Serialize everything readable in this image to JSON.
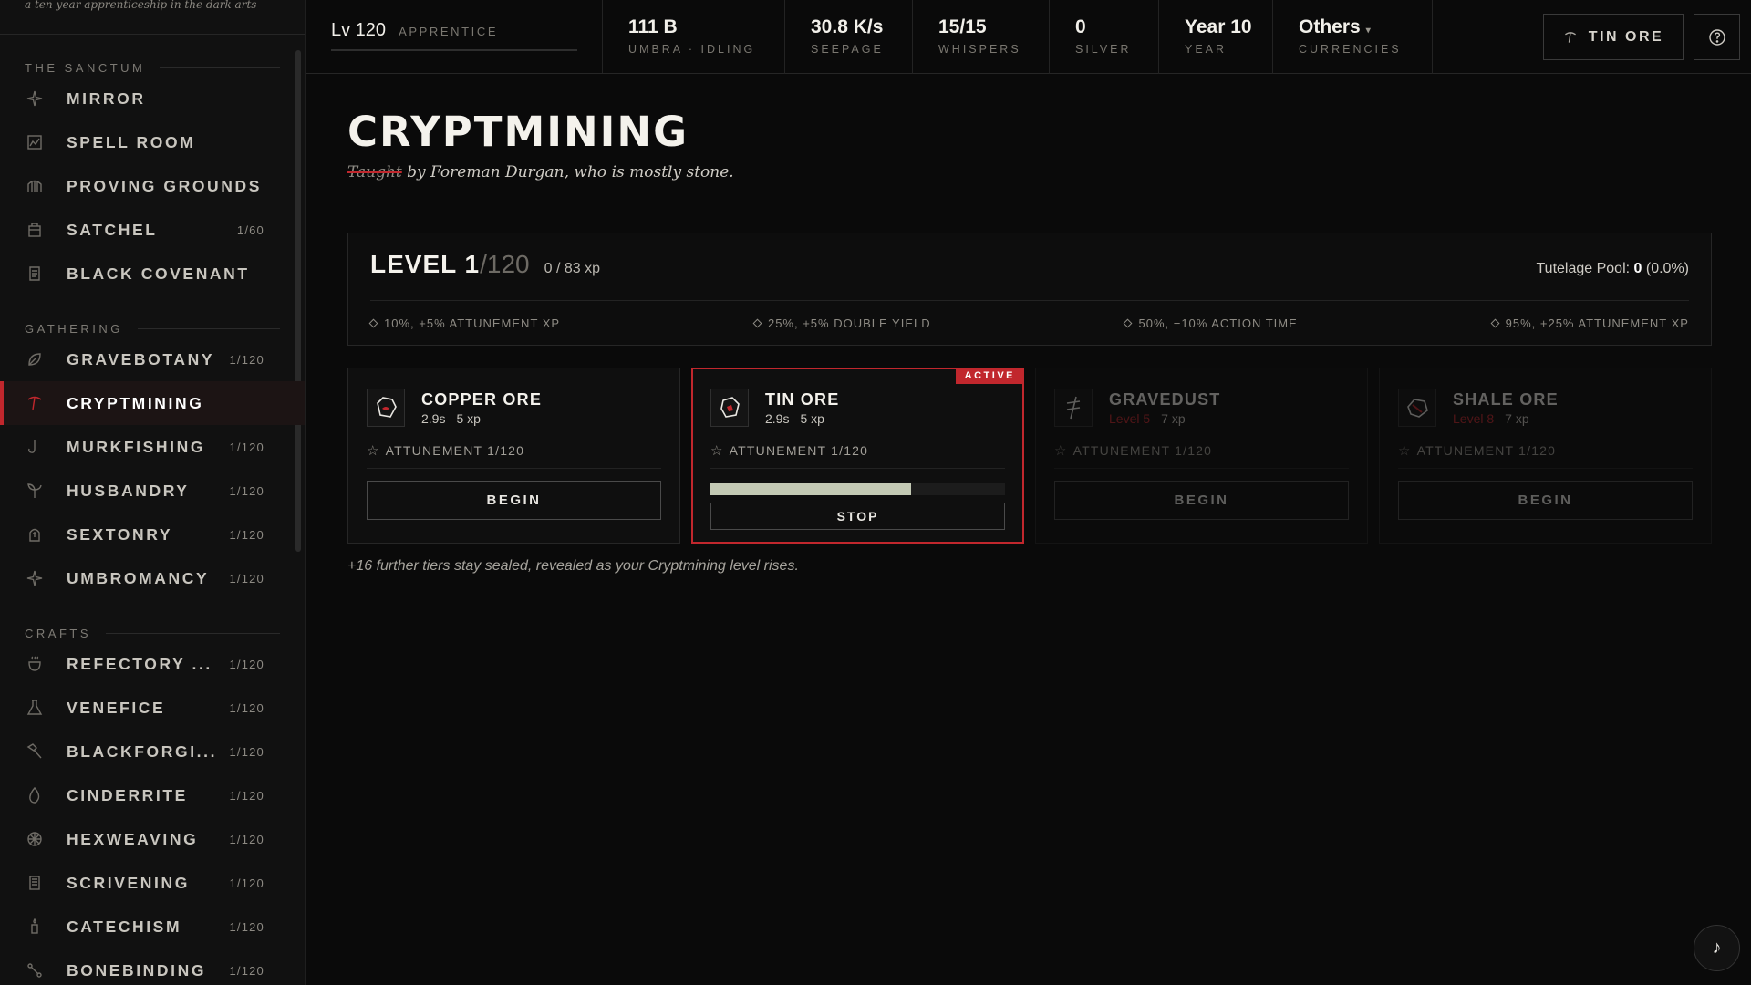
{
  "sidebar": {
    "tagline": "a ten-year apprenticeship in the dark arts",
    "sections": [
      {
        "title": "THE SANCTUM",
        "items": [
          {
            "label": "MIRROR",
            "count": "",
            "icon": "sparkle-icon"
          },
          {
            "label": "SPELL ROOM",
            "count": "",
            "icon": "chart-icon"
          },
          {
            "label": "PROVING GROUNDS",
            "count": "",
            "icon": "gate-icon"
          },
          {
            "label": "SATCHEL",
            "count": "1/60",
            "icon": "bag-icon"
          },
          {
            "label": "BLACK COVENANT",
            "count": "",
            "icon": "scroll-icon"
          }
        ]
      },
      {
        "title": "GATHERING",
        "items": [
          {
            "label": "GRAVEBOTANY",
            "count": "1/120",
            "icon": "leaf-icon"
          },
          {
            "label": "CRYPTMINING",
            "count": "",
            "icon": "pickaxe-icon",
            "active": true
          },
          {
            "label": "MURKFISHING",
            "count": "1/120",
            "icon": "hook-icon"
          },
          {
            "label": "HUSBANDRY",
            "count": "1/120",
            "icon": "sprout-icon"
          },
          {
            "label": "SEXTONRY",
            "count": "1/120",
            "icon": "tomb-icon"
          },
          {
            "label": "UMBROMANCY",
            "count": "1/120",
            "icon": "sparkle-icon"
          }
        ]
      },
      {
        "title": "CRAFTS",
        "items": [
          {
            "label": "REFECTORY ...",
            "count": "1/120",
            "icon": "pot-icon"
          },
          {
            "label": "VENEFICE",
            "count": "1/120",
            "icon": "flask-icon"
          },
          {
            "label": "BLACKFORGI...",
            "count": "1/120",
            "icon": "hammer-icon"
          },
          {
            "label": "CINDERRITE",
            "count": "1/120",
            "icon": "flame-icon"
          },
          {
            "label": "HEXWEAVING",
            "count": "1/120",
            "icon": "web-icon"
          },
          {
            "label": "SCRIVENING",
            "count": "1/120",
            "icon": "quill-icon"
          },
          {
            "label": "CATECHISM",
            "count": "1/120",
            "icon": "candle-icon"
          },
          {
            "label": "BONEBINDING",
            "count": "1/120",
            "icon": "bone-icon"
          }
        ]
      }
    ]
  },
  "topbar": {
    "level": "Lv 120",
    "rank": "APPRENTICE",
    "stats": [
      {
        "value": "111 B",
        "label": "UMBRA · IDLING"
      },
      {
        "value": "30.8 K/s",
        "label": "SEEPAGE"
      },
      {
        "value": "15/15",
        "label": "WHISPERS"
      },
      {
        "value": "0",
        "label": "SILVER"
      },
      {
        "value": "Year 10",
        "label": "YEAR"
      },
      {
        "value": "Others",
        "label": "CURRENCIES",
        "dropdown": true
      }
    ],
    "action_label": "TIN ORE"
  },
  "page": {
    "title": "CRYPTMINING",
    "subtitle_struck": "Taught",
    "subtitle_rest": " by Foreman Durgan, who is mostly stone."
  },
  "level_panel": {
    "level": "LEVEL 1",
    "max": "/120",
    "xp": "0 / 83 xp",
    "pool_label": "Tutelage Pool: ",
    "pool_value": "0",
    "pool_pct": " (0.0%)",
    "milestones": [
      "10%, +5% ATTUNEMENT XP",
      "25%, +5% DOUBLE YIELD",
      "50%, −10% ACTION TIME",
      "95%, +25% ATTUNEMENT XP"
    ]
  },
  "cards": [
    {
      "name": "COPPER ORE",
      "time": "2.9s",
      "xp": "5 xp",
      "attunement": "ATTUNEMENT 1/120",
      "button": "BEGIN",
      "state": "idle",
      "icon": "copper-ore-icon"
    },
    {
      "name": "TIN ORE",
      "time": "2.9s",
      "xp": "5 xp",
      "attunement": "ATTUNEMENT 1/120",
      "button": "STOP",
      "state": "active",
      "badge": "ACTIVE",
      "progress": 0.68,
      "icon": "tin-ore-icon"
    },
    {
      "name": "GRAVEDUST",
      "requirement": "Level 5",
      "xp": "7 xp",
      "attunement": "ATTUNEMENT 1/120",
      "button": "BEGIN",
      "state": "locked",
      "icon": "gravedust-icon"
    },
    {
      "name": "SHALE ORE",
      "requirement": "Level 8",
      "xp": "7 xp",
      "attunement": "ATTUNEMENT 1/120",
      "button": "BEGIN",
      "state": "locked",
      "icon": "shale-ore-icon"
    }
  ],
  "footnote": "+16 further tiers stay sealed, revealed as your Cryptmining level rises.",
  "colors": {
    "accent": "#c1272d",
    "background": "#0a0a0a",
    "progress": "#c3c9b4"
  }
}
